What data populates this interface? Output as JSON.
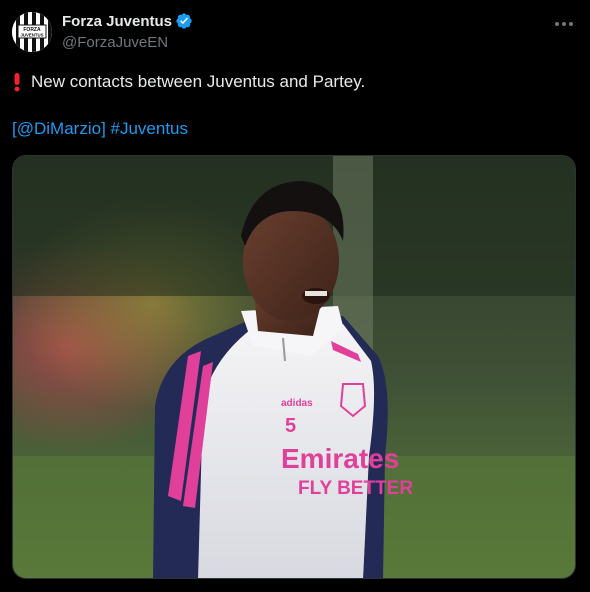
{
  "author": {
    "display_name": "Forza Juventus",
    "handle": "@ForzaJuveEN",
    "verified": true,
    "avatar_text": "FORZA JUVENTUS"
  },
  "tweet": {
    "line1_icon": "exclamation-icon",
    "line1_text": "New contacts between Juventus and Partey.",
    "line2_open": "[",
    "mention": "@DiMarzio",
    "line2_close": "] ",
    "hashtag": "#Juventus"
  },
  "media": {
    "description_icon": "player-photo",
    "shirt_text_1": "Emirates",
    "shirt_text_2": "FLY BETTER",
    "shirt_number": "5",
    "brand_text": "adidas"
  },
  "colors": {
    "background": "#000000",
    "text": "#e7e9ea",
    "secondary": "#71767b",
    "link": "#1d9bf0",
    "exclamation": "#f4212e"
  }
}
